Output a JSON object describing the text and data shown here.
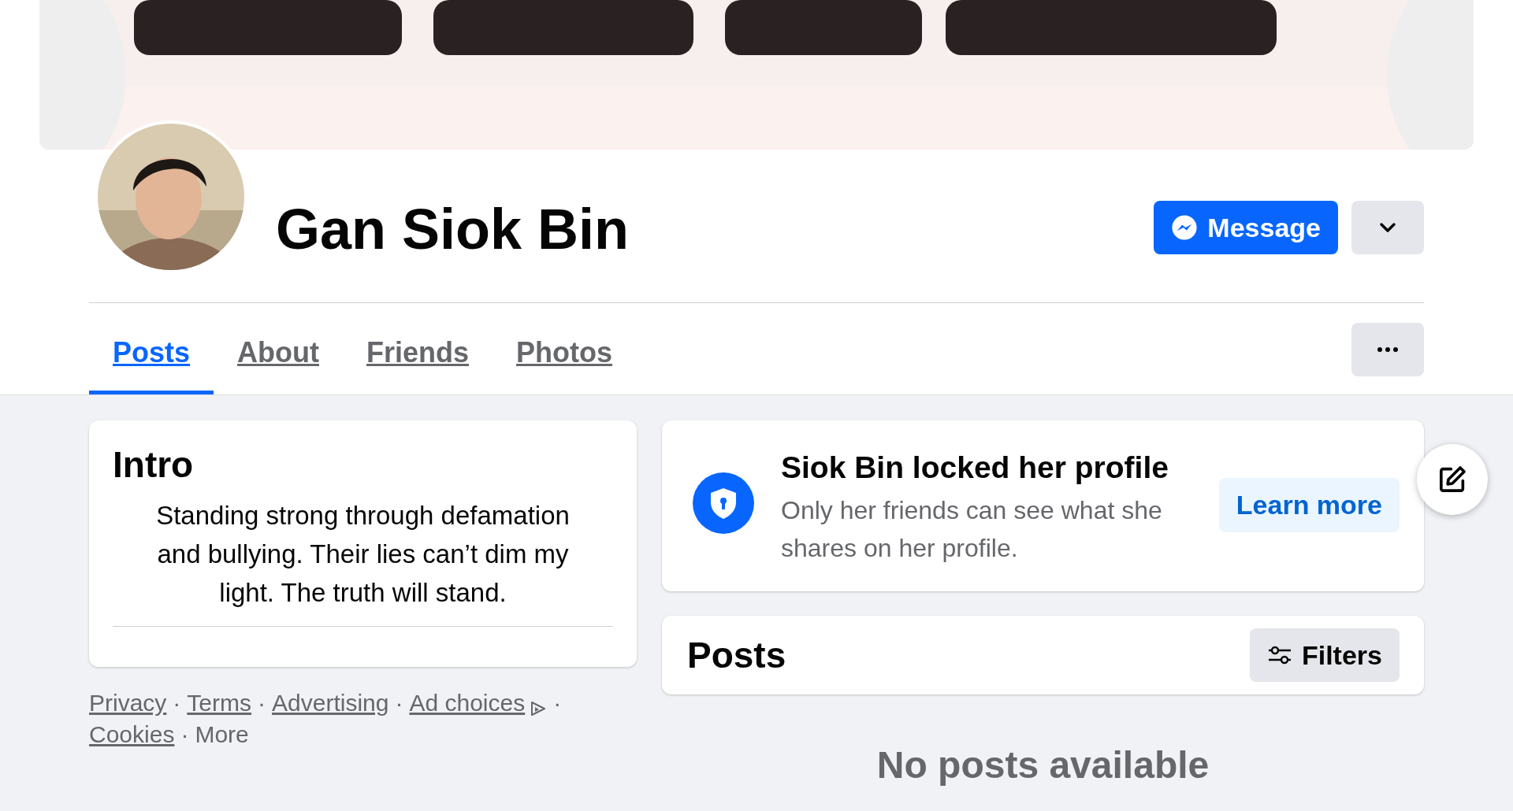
{
  "profile": {
    "name": "Gan Siok Bin"
  },
  "actions": {
    "message": "Message"
  },
  "tabs": [
    {
      "label": "Posts",
      "selected": true
    },
    {
      "label": "About",
      "selected": false
    },
    {
      "label": "Friends",
      "selected": false
    },
    {
      "label": "Photos",
      "selected": false
    }
  ],
  "intro": {
    "title": "Intro",
    "bio": "Standing strong through defamation and bullying. Their lies can’t dim my light. The truth will stand."
  },
  "footer": {
    "separator": "·",
    "links": [
      {
        "label": "Privacy",
        "kind": "link"
      },
      {
        "label": "Terms",
        "kind": "link"
      },
      {
        "label": "Advertising",
        "kind": "link"
      },
      {
        "label": "Ad choices",
        "kind": "ad_choices"
      },
      {
        "label": "Cookies",
        "kind": "link"
      },
      {
        "label": "More",
        "kind": "text"
      }
    ]
  },
  "locked_notice": {
    "title": "Siok Bin locked her profile",
    "body": "Only her friends can see what she shares on her profile.",
    "button": "Learn more"
  },
  "posts": {
    "title": "Posts",
    "filters": "Filters",
    "empty": "No posts available"
  }
}
